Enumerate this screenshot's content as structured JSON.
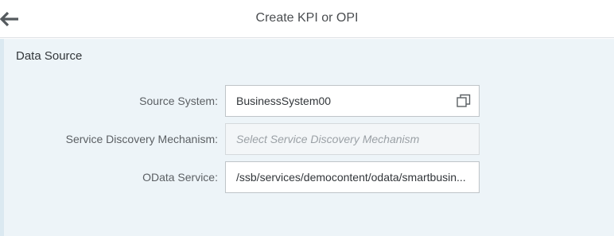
{
  "header": {
    "back_icon": "arrow-left-icon",
    "title": "Create KPI or OPI"
  },
  "data_source": {
    "section_title": "Data Source",
    "fields": [
      {
        "label": "Source System:",
        "value": "BusinessSystem00",
        "icon": "value-help-icon"
      },
      {
        "label": "Service Discovery Mechanism:",
        "value": "",
        "placeholder": "Select Service Discovery Mechanism"
      },
      {
        "label": "OData Service:",
        "value": "/ssb/services/democontent/odata/smartbusin..."
      }
    ]
  },
  "colors": {
    "header_bg": "#ffffff",
    "content_bg": "#edf4f8",
    "text_primary": "#32363a",
    "label_text": "#5b5f63",
    "placeholder_text": "#9ba1a6",
    "border": "#bfc4c8"
  }
}
